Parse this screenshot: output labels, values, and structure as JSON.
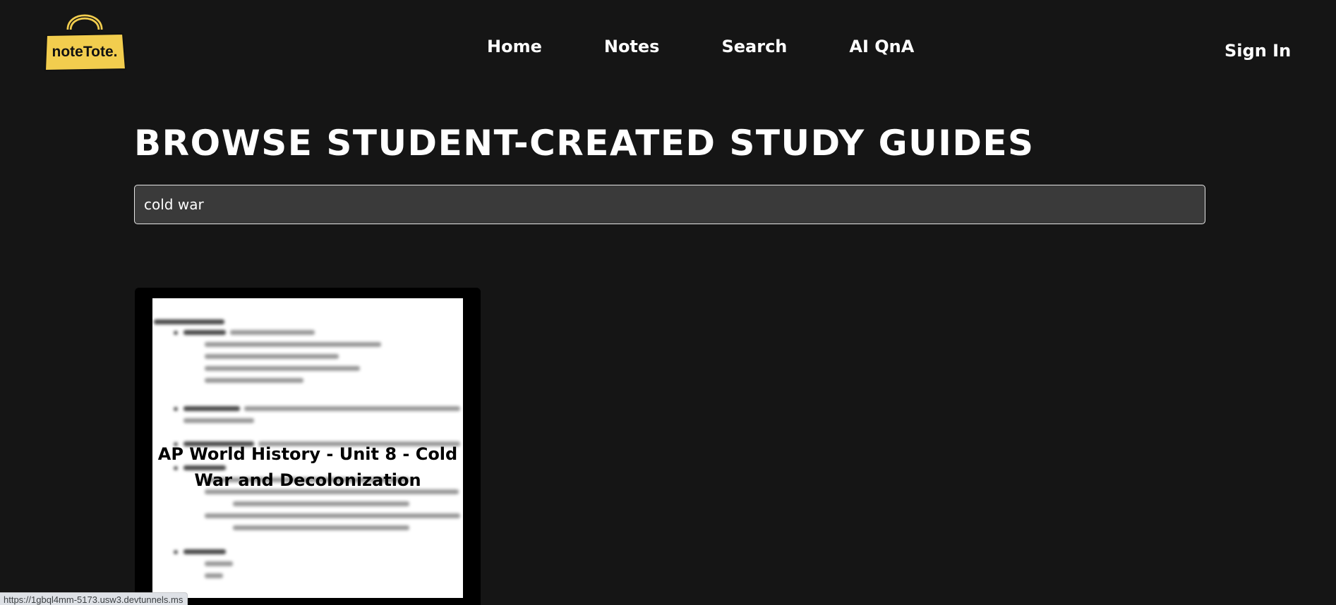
{
  "header": {
    "logo_text": "noteTote.",
    "nav": [
      {
        "label": "Home"
      },
      {
        "label": "Notes"
      },
      {
        "label": "Search"
      },
      {
        "label": "AI QnA"
      }
    ],
    "sign_in_label": "Sign In"
  },
  "main": {
    "page_title": "BROWSE STUDENT-CREATED STUDY GUIDES",
    "search": {
      "value": "cold war"
    },
    "results": [
      {
        "title": "AP World History - Unit 8 - Cold War and Decolonization"
      }
    ]
  },
  "status_bar": {
    "url": "https://1gbql4mm-5173.usw3.devtunnels.ms"
  },
  "colors": {
    "background": "#151515",
    "logo_yellow": "#f2cd4e",
    "search_bg": "#3a3a3a",
    "card_bg": "#000000"
  }
}
